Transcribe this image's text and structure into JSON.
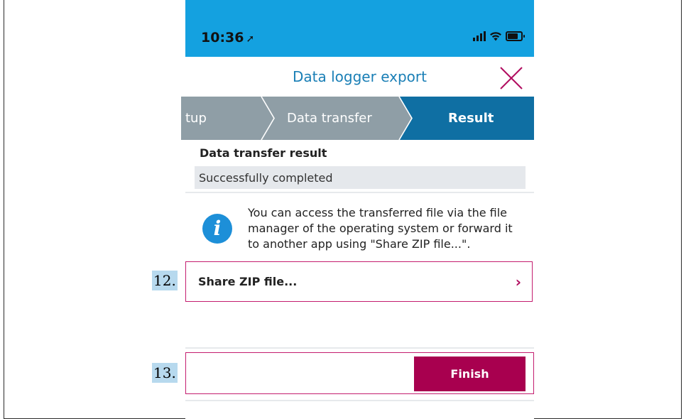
{
  "status_bar": {
    "time": "10:36",
    "location_arrow": "➚"
  },
  "header": {
    "title": "Data logger export",
    "close_icon": "close-icon"
  },
  "steps": [
    {
      "label": "tup",
      "state": "done"
    },
    {
      "label": "Data transfer",
      "state": "done"
    },
    {
      "label": "Result",
      "state": "active"
    }
  ],
  "result": {
    "section_title": "Data transfer result",
    "value": "Successfully completed"
  },
  "info": {
    "icon": "info-icon",
    "lines": [
      "You can access the transferred file via the file",
      "manager of the operating system or forward it",
      "to another app using \"Share ZIP file...\"."
    ]
  },
  "share": {
    "label": "Share ZIP file...",
    "chevron": "›"
  },
  "finish": {
    "label": "Finish"
  },
  "annotations": {
    "step12": "12.",
    "step13": "13."
  },
  "colors": {
    "status_bar": "#14a1e0",
    "step_done": "#8f9ea6",
    "step_active": "#0f6fa3",
    "accent": "#a8004f",
    "highlight": "#c41d6f"
  }
}
